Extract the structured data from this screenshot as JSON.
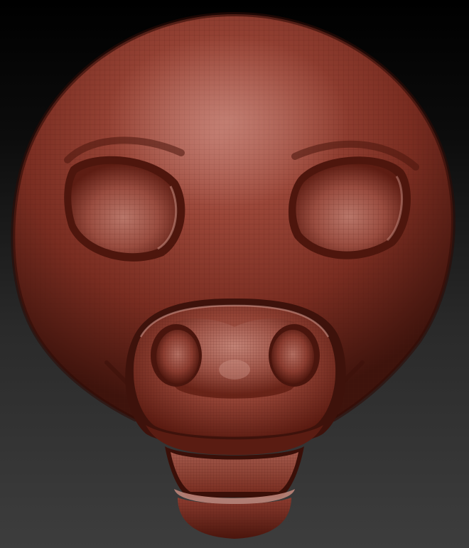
{
  "scene": {
    "subject": "sculpted-animal-head",
    "colors": {
      "background_top": "#000000",
      "background_bottom": "#3d3d3d",
      "clay_base": "#8a3a2c",
      "clay_highlight": "#c98677",
      "clay_shadow": "#3e120c",
      "wireframe": "#5a1f16"
    }
  }
}
